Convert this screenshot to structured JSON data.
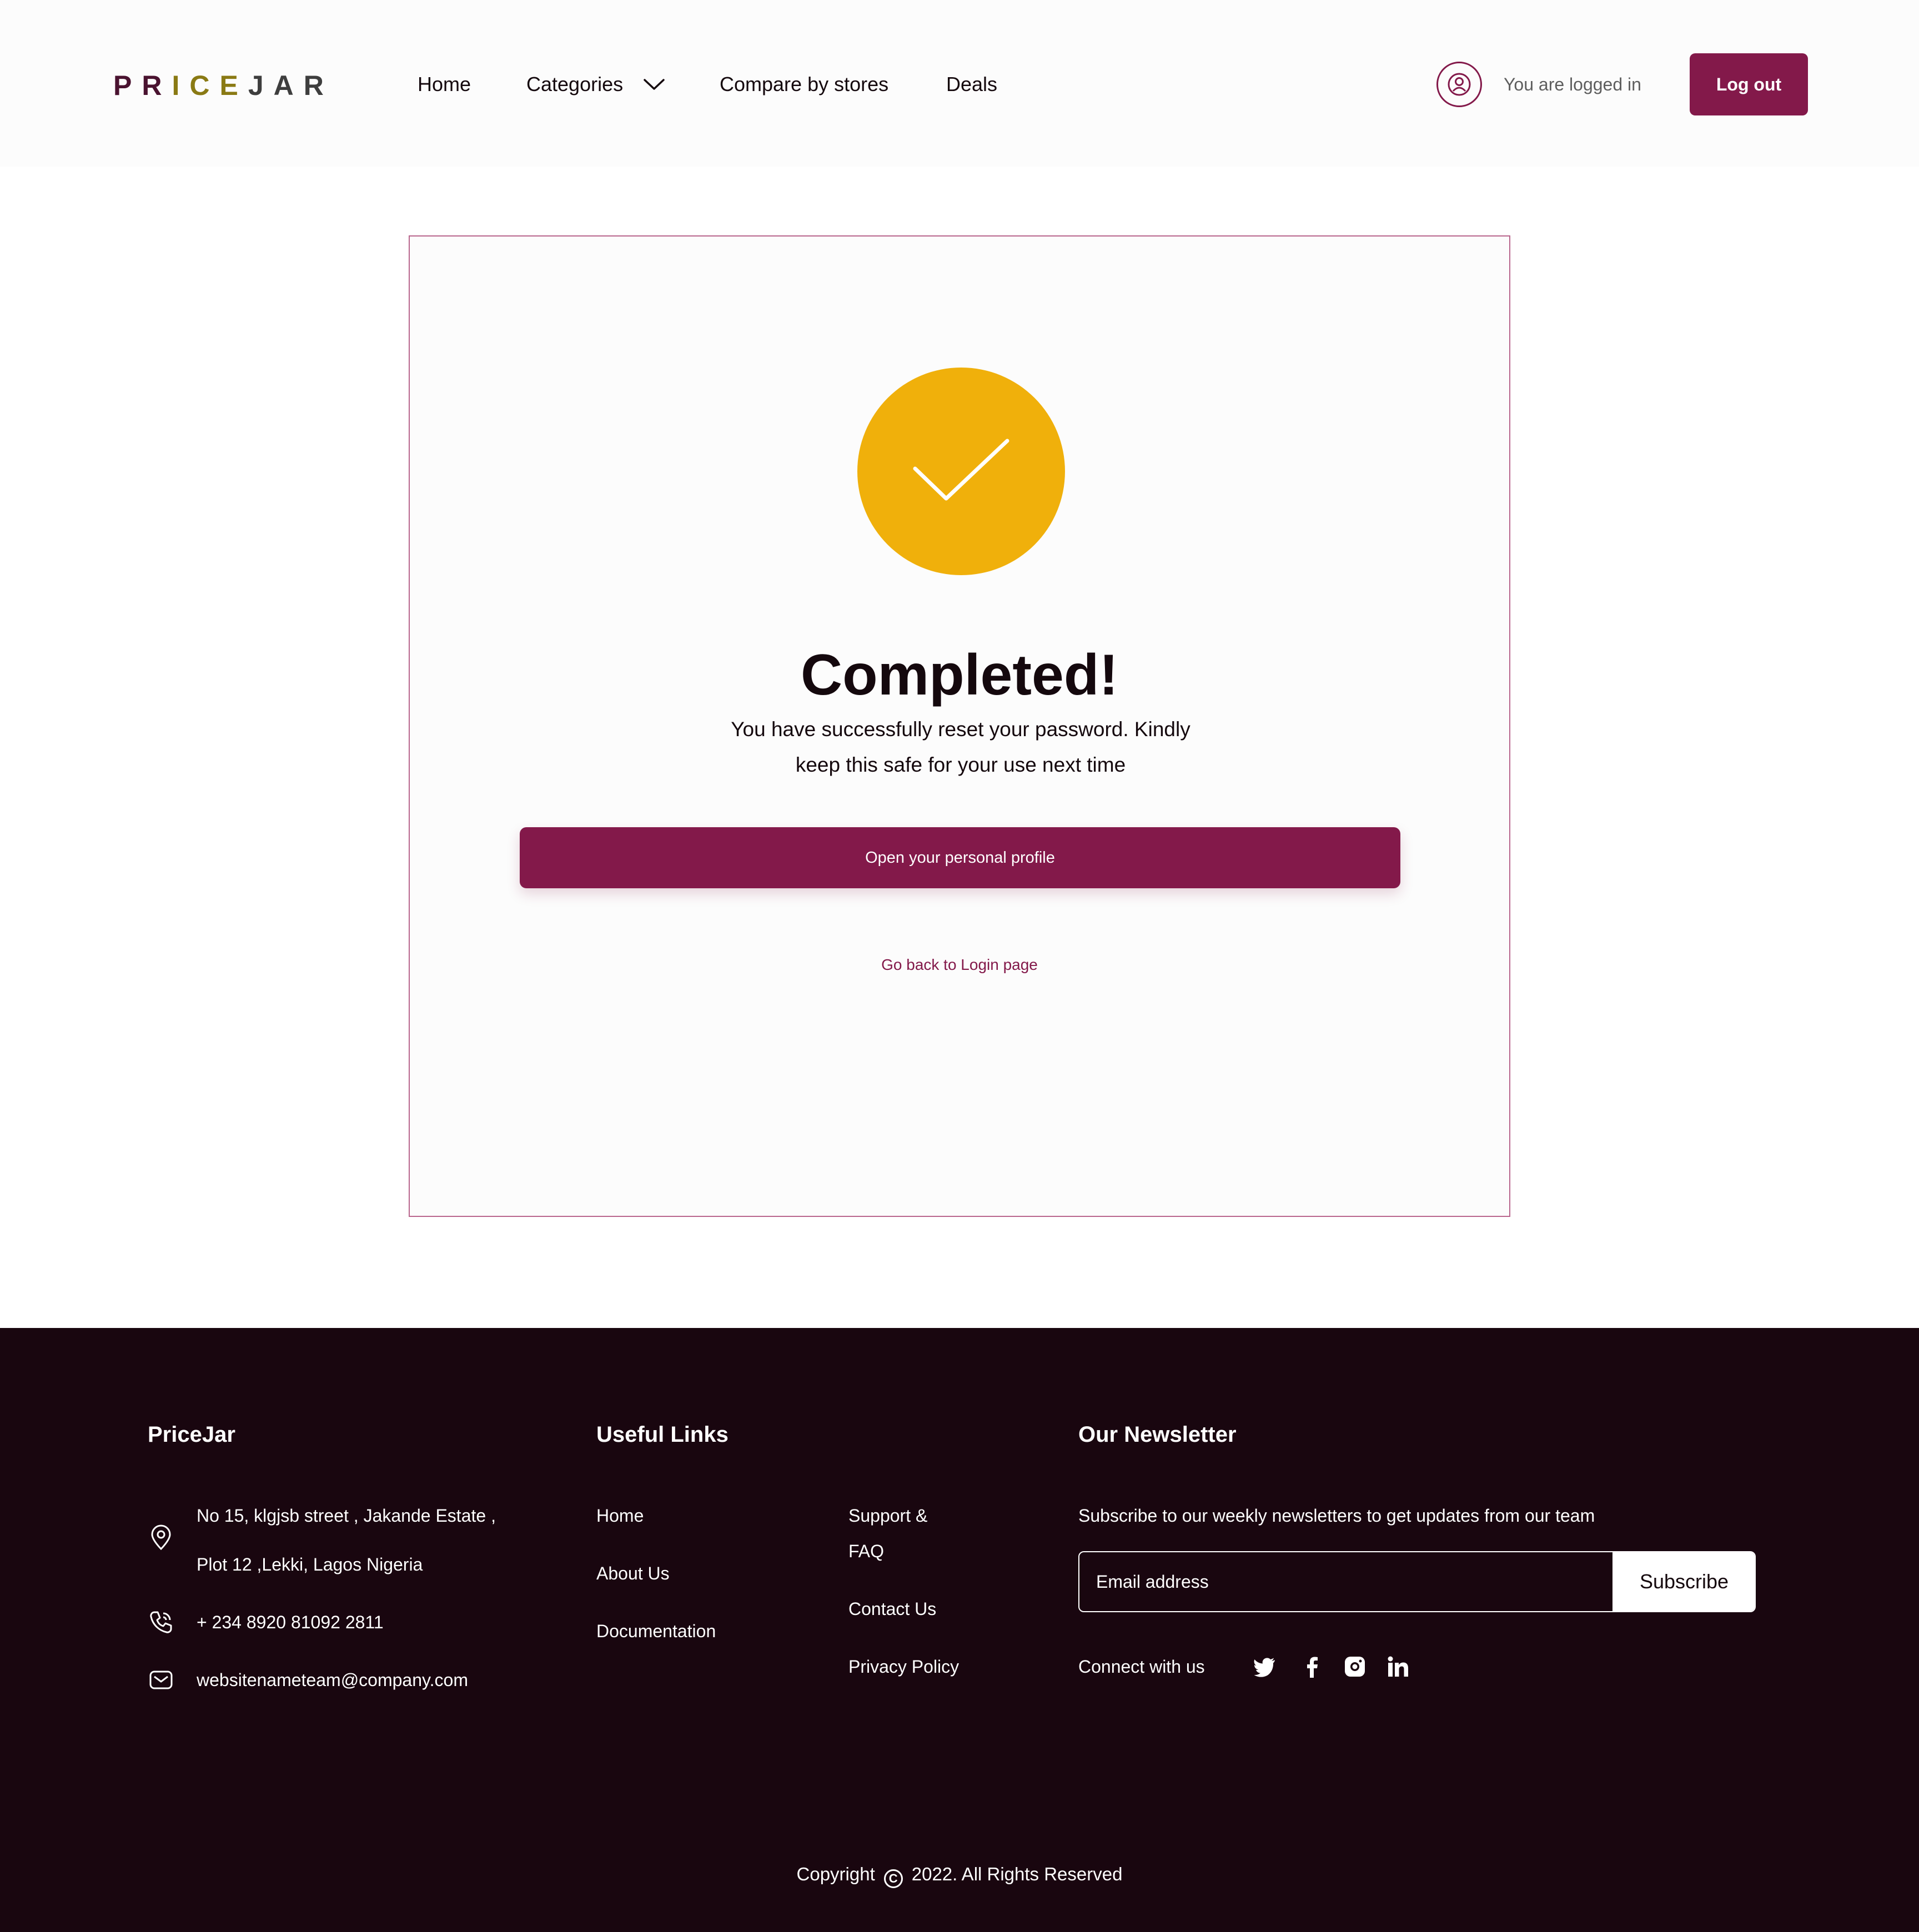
{
  "header": {
    "logo": {
      "part1": "PR",
      "part2": "ICE",
      "part3": "JAR"
    },
    "nav": {
      "home": "Home",
      "categories": "Categories",
      "compare": "Compare by stores",
      "deals": "Deals"
    },
    "user_status": "You are logged in",
    "logout_label": "Log out"
  },
  "card": {
    "icon": "checkmark-icon",
    "title": "Completed!",
    "subtitle": "You have successfully reset your password. Kindly keep this safe for your use next time",
    "primary_button": "Open your personal profile",
    "back_link": "Go back to Login page"
  },
  "footer": {
    "brand": {
      "title": "PriceJar",
      "address_line1": "No 15, klgjsb street , Jakande Estate ,",
      "address_line2": "Plot 12 ,Lekki, Lagos Nigeria",
      "phone": "+ 234 8920 81092 2811",
      "email": "websitenameteam@company.com"
    },
    "links": {
      "title": "Useful Links",
      "home": "Home",
      "about": "About Us",
      "documentation": "Documentation",
      "support_line1": "Support &",
      "support_line2": "FAQ",
      "contact": "Contact Us",
      "privacy": "Privacy Policy"
    },
    "newsletter": {
      "title": "Our Newsletter",
      "description": "Subscribe to our weekly newsletters to get updates from our team",
      "email_placeholder": "Email address",
      "subscribe_label": "Subscribe",
      "connect_label": "Connect with us"
    },
    "copyright_before": "Copyright",
    "copyright_symbol": "C",
    "copyright_after": "2022. All Rights Reserved"
  },
  "colors": {
    "brand": "#83194a",
    "accent_yellow": "#f0b00b",
    "footer_bg": "#19060f"
  }
}
